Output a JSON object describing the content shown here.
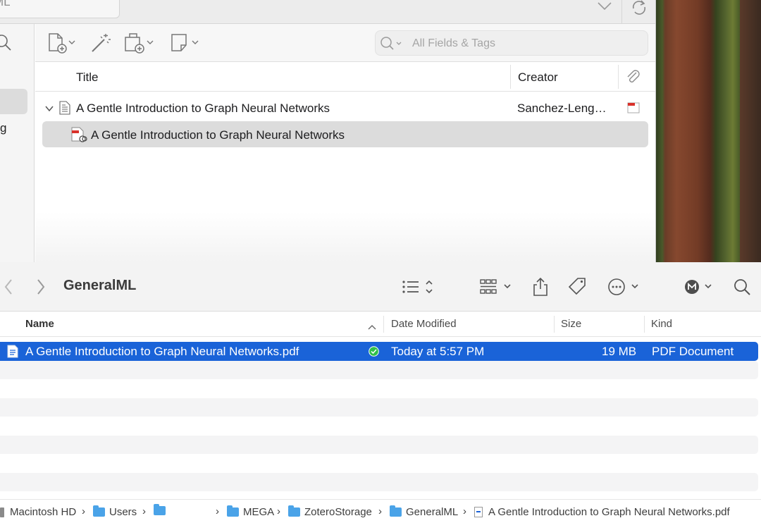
{
  "zotero": {
    "collection_name": "ML",
    "search_placeholder": "All Fields & Tags",
    "left_item_label": "g",
    "columns": {
      "title": "Title",
      "creator": "Creator"
    },
    "items": [
      {
        "title": "A Gentle Introduction to Graph Neural Networks",
        "creator": "Sanchez-Leng…"
      },
      {
        "title": "A Gentle Introduction to Graph Neural Networks"
      }
    ]
  },
  "finder": {
    "title": "GeneralML",
    "columns": {
      "name": "Name",
      "date_modified": "Date Modified",
      "size": "Size",
      "kind": "Kind"
    },
    "file": {
      "name": "A Gentle Introduction to Graph Neural Networks.pdf",
      "date_modified": "Today at 5:57 PM",
      "size": "19 MB",
      "kind": "PDF Document"
    },
    "path": {
      "macintosh_hd": "Macintosh HD",
      "users": "Users",
      "mega": "MEGA",
      "zotero_storage": "ZoteroStorage",
      "general_ml": "GeneralML",
      "file": "A Gentle Introduction to Graph Neural Networks.pdf"
    }
  },
  "colors": {
    "selection_blue": "#1a63d8",
    "synced_green": "#30c04a",
    "pdf_red": "#d9322b"
  }
}
